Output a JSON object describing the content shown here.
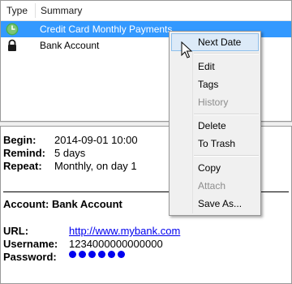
{
  "list": {
    "columns": {
      "type": "Type",
      "summary": "Summary"
    },
    "rows": [
      {
        "icon": "clock-icon",
        "summary": "Credit Card Monthly Payments",
        "selected": true
      },
      {
        "icon": "lock-icon",
        "summary": "Bank Account",
        "selected": false
      }
    ]
  },
  "details": {
    "begin_label": "Begin:",
    "begin_value": "2014-09-01 10:00",
    "remind_label": "Remind:",
    "remind_value": "5 days",
    "repeat_label": "Repeat:",
    "repeat_value": "Monthly, on day 1",
    "account_title": "Account: Bank Account",
    "url_label": "URL:",
    "url_value": "http://www.mybank.com",
    "username_label": "Username:",
    "username_value": "1234000000000000",
    "password_label": "Password:",
    "password_dots": 6
  },
  "context_menu": {
    "next_date": "Next Date",
    "edit": "Edit",
    "tags": "Tags",
    "history": "History",
    "delete": "Delete",
    "to_trash": "To Trash",
    "copy": "Copy",
    "attach": "Attach",
    "save_as": "Save As..."
  },
  "colors": {
    "selection": "#3399ff",
    "link": "#0000ee",
    "clock_icon": "#4caf50"
  }
}
